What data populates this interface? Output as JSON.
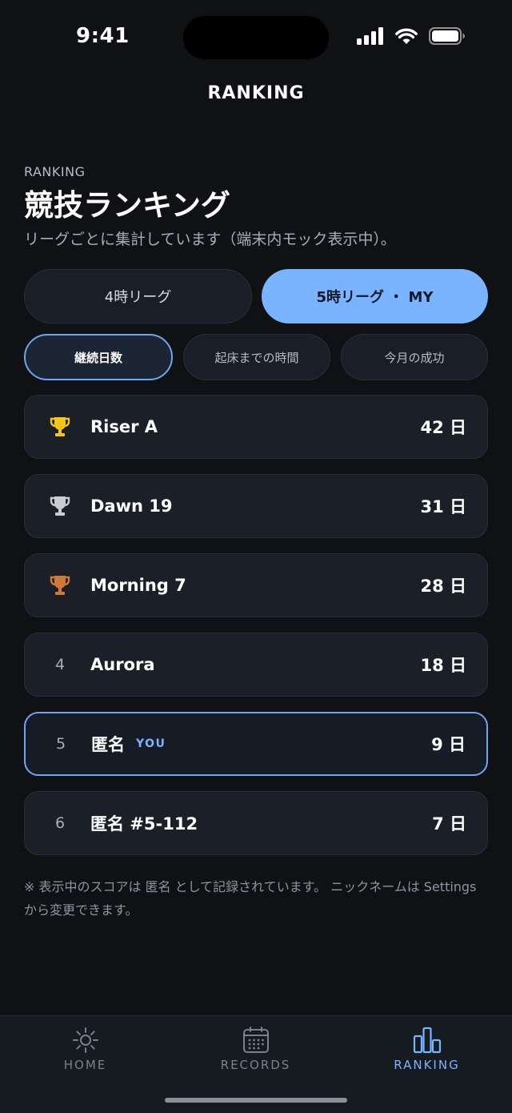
{
  "status_bar": {
    "time": "9:41"
  },
  "nav": {
    "title": "RANKING"
  },
  "header": {
    "eyebrow": "RANKING",
    "title": "競技ランキング",
    "subtitle": "リーグごとに集計しています（端末内モック表示中）。"
  },
  "leagues": [
    {
      "label": "4時リーグ",
      "active": false
    },
    {
      "label": "5時リーグ ・ MY",
      "active": true
    }
  ],
  "metrics": [
    {
      "label": "継続日数",
      "active": true
    },
    {
      "label": "起床までの時間",
      "active": false
    },
    {
      "label": "今月の成功",
      "active": false
    }
  ],
  "rankings": [
    {
      "rank": "1",
      "trophy": "gold",
      "name": "Riser A",
      "badge": "",
      "score": "42 日"
    },
    {
      "rank": "2",
      "trophy": "silver",
      "name": "Dawn 19",
      "badge": "",
      "score": "31 日"
    },
    {
      "rank": "3",
      "trophy": "bronze",
      "name": "Morning 7",
      "badge": "",
      "score": "28 日"
    },
    {
      "rank": "4",
      "trophy": "",
      "name": "Aurora",
      "badge": "",
      "score": "18 日"
    },
    {
      "rank": "5",
      "trophy": "",
      "name": "匿名",
      "badge": "YOU",
      "score": "9 日"
    },
    {
      "rank": "6",
      "trophy": "",
      "name": "匿名 #5-112",
      "badge": "",
      "score": "7 日"
    }
  ],
  "footnote": "※ 表示中のスコアは 匿名 として記録されています。 ニックネームは Settings から変更できます。",
  "tab_bar": {
    "items": [
      {
        "label": "HOME",
        "icon": "sun-icon",
        "active": false
      },
      {
        "label": "RECORDS",
        "icon": "calendar-icon",
        "active": false
      },
      {
        "label": "RANKING",
        "icon": "bar-chart-icon",
        "active": true
      }
    ]
  },
  "colors": {
    "background": "#0f1115",
    "accent": "#7ab3ff",
    "gold": "#f5c518",
    "silver": "#c9ccd2",
    "bronze": "#d07a35"
  }
}
